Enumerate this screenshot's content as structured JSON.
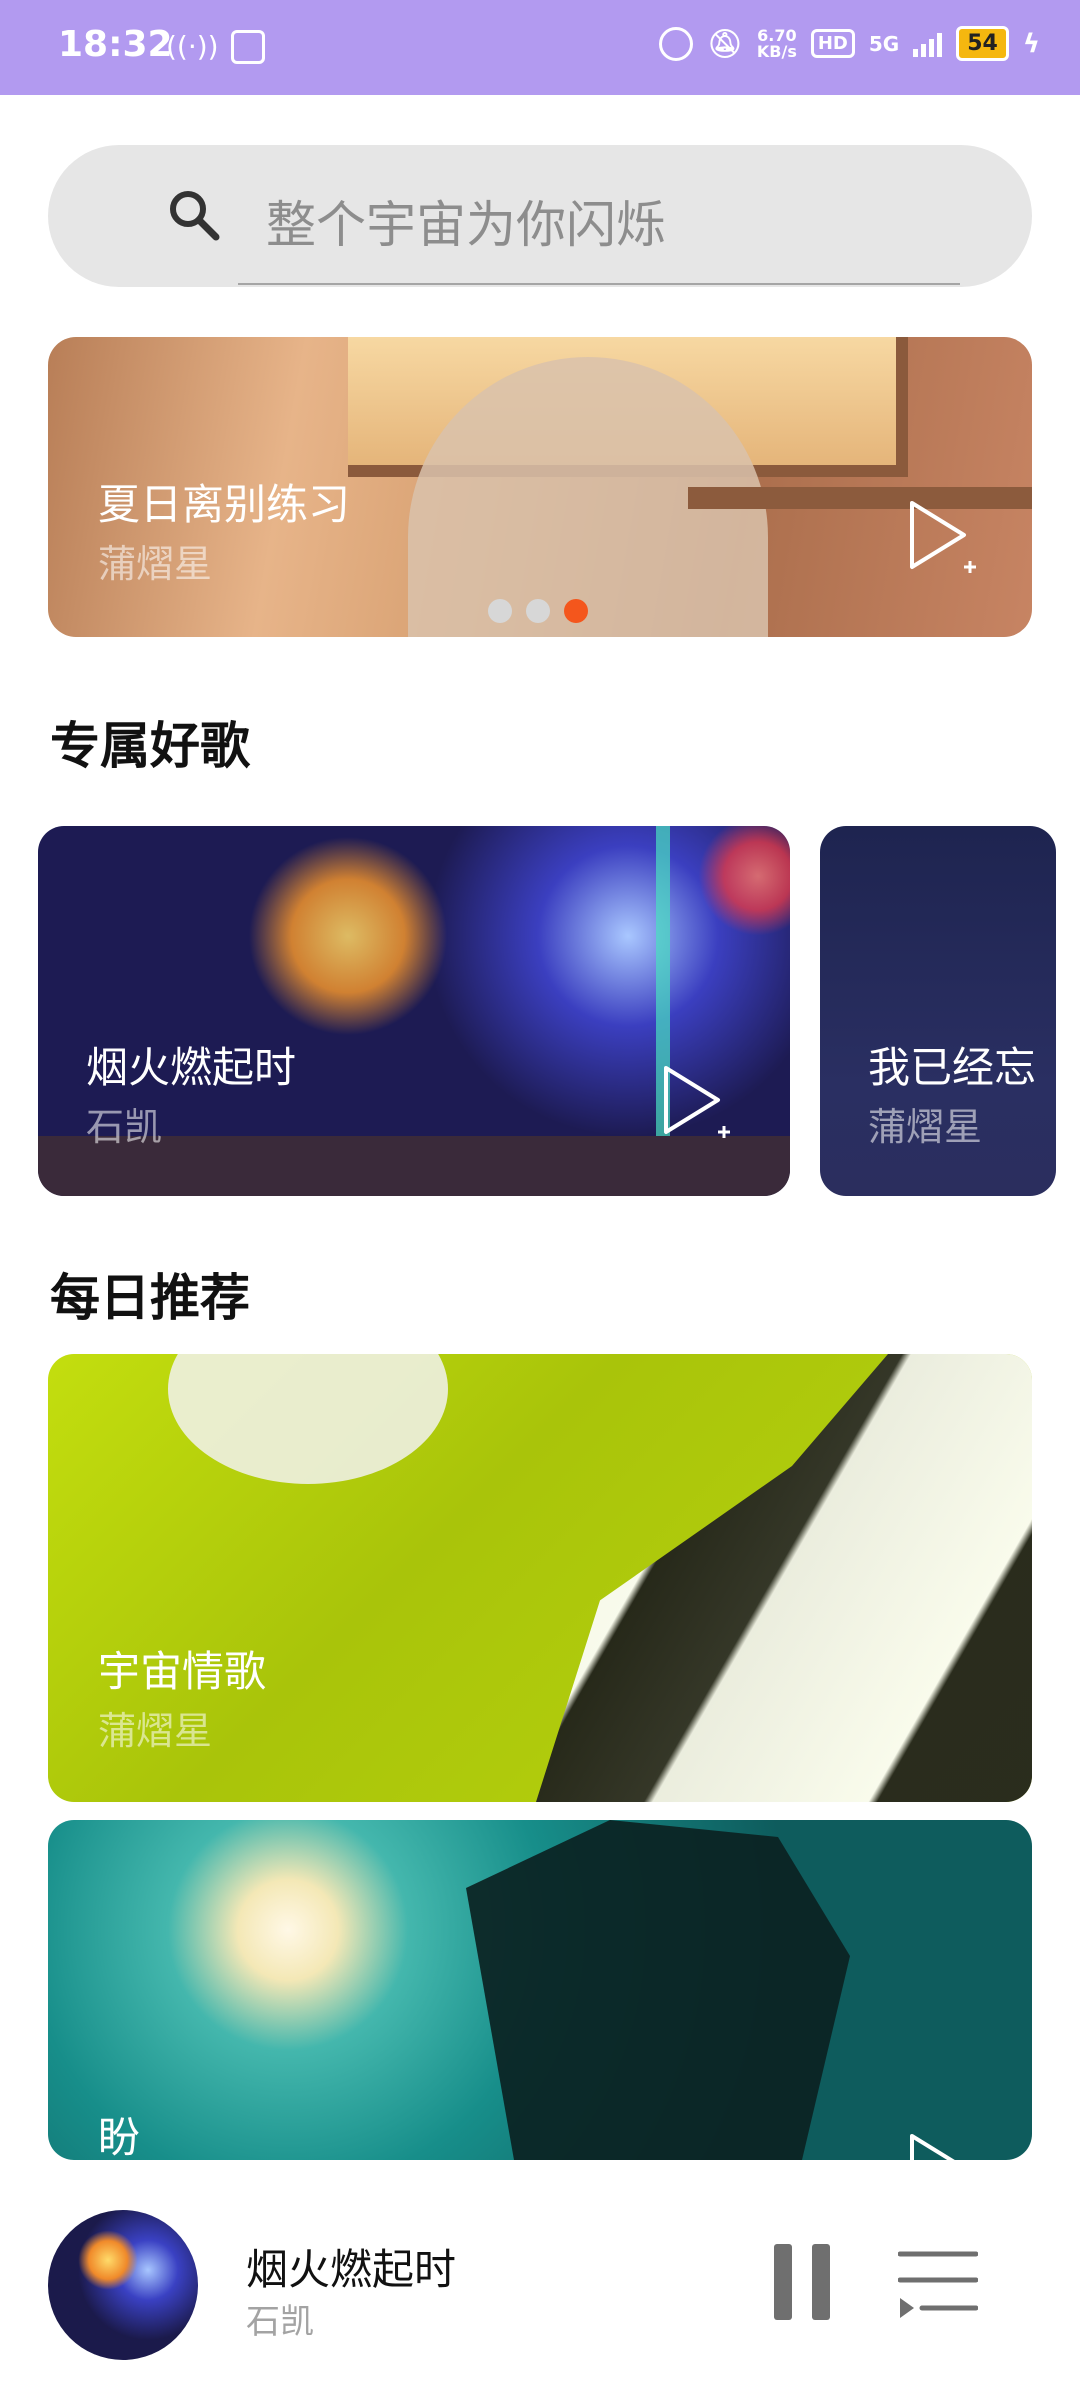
{
  "status_bar": {
    "time": "18:32",
    "network_speed": "6.70",
    "network_unit": "KB/s",
    "hd": "HD",
    "network_type": "5G",
    "battery": "54"
  },
  "search": {
    "placeholder": "整个宇宙为你闪烁"
  },
  "banner": {
    "title": "夏日离别练习",
    "artist": "蒲熠星",
    "carousel_index": 3,
    "carousel_total": 3
  },
  "sections": {
    "exclusive": "专属好歌",
    "daily": "每日推荐"
  },
  "exclusive_cards": [
    {
      "title": "烟火燃起时",
      "artist": "石凯"
    },
    {
      "title": "我已经忘",
      "artist": "蒲熠星"
    }
  ],
  "daily_cards": [
    {
      "title": "宇宙情歌",
      "artist": "蒲熠星"
    },
    {
      "title": "盼",
      "artist": ""
    }
  ],
  "mini_player": {
    "title": "烟火燃起时",
    "artist": "石凯"
  },
  "colors": {
    "status_bar": "#b29af0",
    "dot_active": "#f4561c",
    "battery": "#f5b70f"
  }
}
